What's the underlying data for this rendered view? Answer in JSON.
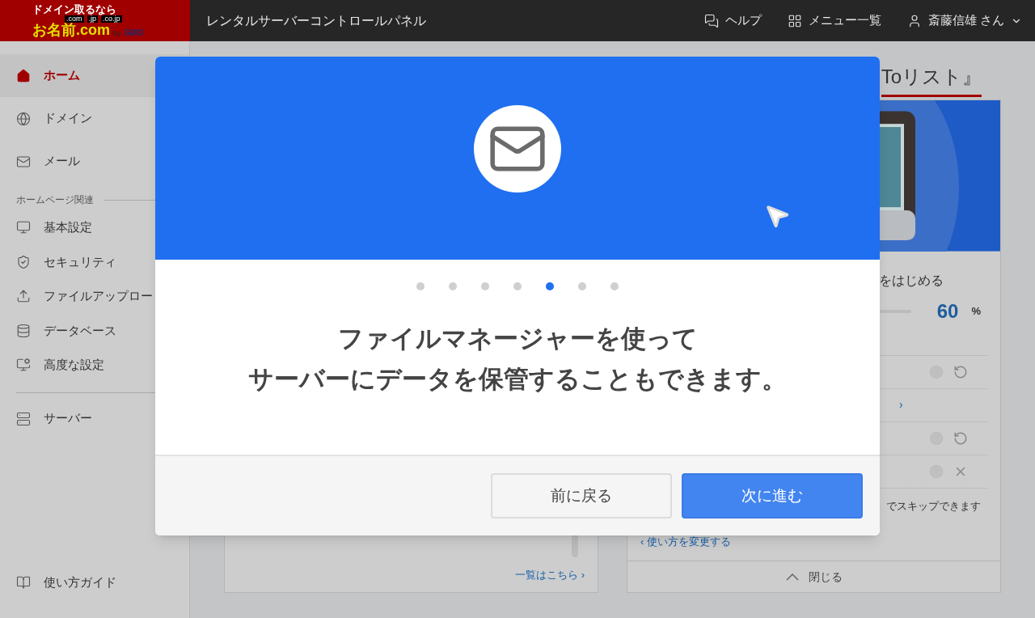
{
  "header": {
    "logo": {
      "tagline": "ドメイン取るなら",
      "domains": [
        ".com",
        ".jp",
        ".co.jp"
      ],
      "name": "お名前.com",
      "by": "by",
      "company": "GMO"
    },
    "title": "レンタルサーバーコントロールパネル",
    "links": [
      {
        "label": "ヘルプ"
      },
      {
        "label": "メニュー一覧"
      }
    ],
    "user": {
      "name": "斎藤信雄",
      "suffix": "さん"
    }
  },
  "sidebar": {
    "items": [
      {
        "label": "ホーム",
        "selected": true
      },
      {
        "label": "ドメイン",
        "selected": false
      },
      {
        "label": "メール",
        "selected": false
      }
    ],
    "section": {
      "label": "ホームページ関連",
      "items": [
        {
          "label": "基本設定",
          "selected": false
        },
        {
          "label": "セキュリティ",
          "selected": false
        },
        {
          "label": "ファイルアップロー",
          "selected": false
        },
        {
          "label": "データベース",
          "selected": false
        },
        {
          "label": "高度な設定",
          "selected": false
        }
      ]
    },
    "server_items": [
      {
        "label": "サーバー",
        "selected": false
      }
    ],
    "footer_item": {
      "label": "使い方ガイド"
    }
  },
  "news_card": {
    "more_link": "一覧はこちら ›"
  },
  "todo_card": {
    "title": "Toリスト』",
    "progress": {
      "label": "をはじめる",
      "value": "60",
      "unit": "%"
    },
    "rows": [
      {
        "kind": "resettable"
      },
      {
        "kind": "link",
        "label": "›"
      },
      {
        "kind": "resettable"
      },
      {
        "kind": "skippable"
      }
    ],
    "note": "でスキップできます",
    "change_link": "‹ 使い方を変更する",
    "close": "閉じる"
  },
  "modal": {
    "dots": [
      {
        "selected": false
      },
      {
        "selected": false
      },
      {
        "selected": false
      },
      {
        "selected": false
      },
      {
        "selected": true
      },
      {
        "selected": false
      },
      {
        "selected": false
      }
    ],
    "message": [
      "ファイルマネージャーを使って",
      "サーバーにデータを保管することもできます。"
    ],
    "buttons": [
      {
        "kind": "secondary",
        "label": "前に戻る"
      },
      {
        "kind": "primary",
        "label": "次に進む"
      }
    ]
  }
}
